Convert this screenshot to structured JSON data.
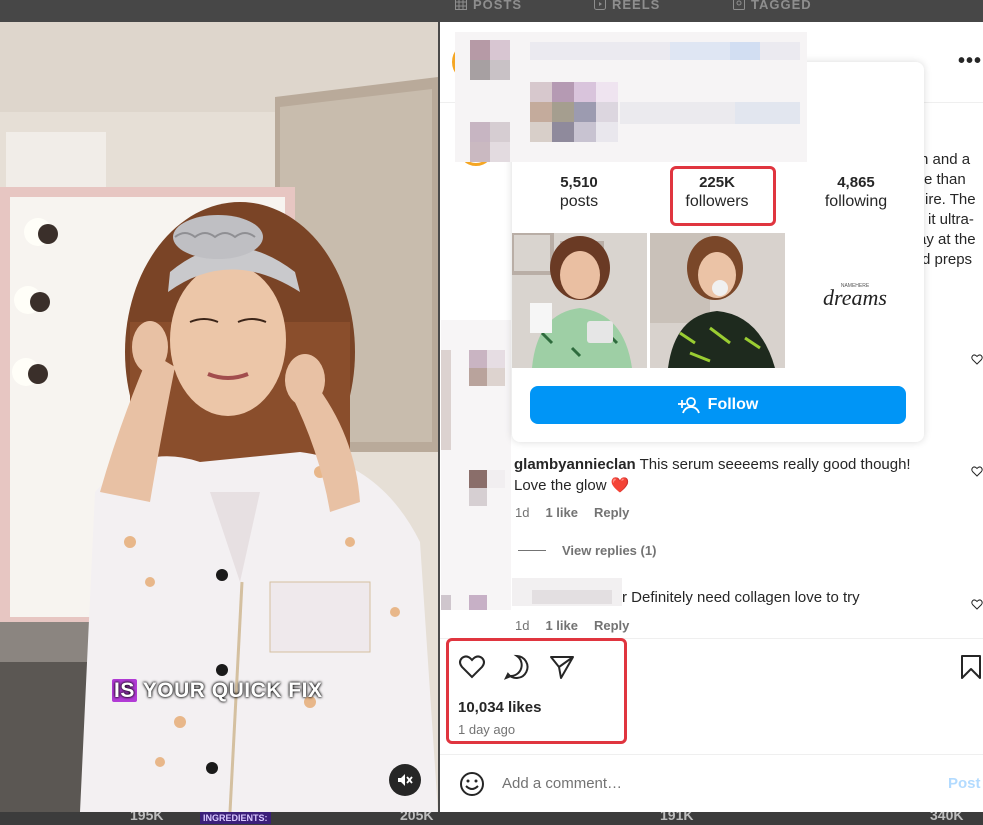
{
  "profile_tabs": [
    {
      "label": "POSTS",
      "icon": "grid-icon"
    },
    {
      "label": "REELS",
      "icon": "reels-icon"
    },
    {
      "label": "TAGGED",
      "icon": "tagged-icon"
    }
  ],
  "video": {
    "caption_highlight": "IS",
    "caption_rest": " YOUR QUICK FIX",
    "mute_icon": "speaker-muted-icon"
  },
  "post": {
    "more_label": "•••",
    "description_lines": [
      "n and a",
      "e than",
      "ire. The",
      "it ultra-",
      "ay at the",
      "d preps"
    ]
  },
  "hover_card": {
    "stats": [
      {
        "num": "5,510",
        "label": "posts"
      },
      {
        "num": "225K",
        "label": "followers"
      },
      {
        "num": "4,865",
        "label": "following"
      }
    ],
    "thumb3_brand": "dreams",
    "thumb3_brand_small": "NAMEHERE",
    "follow_label": "Follow"
  },
  "comments": [
    {
      "username": "glambyannieclan",
      "text": "This serum seeeems really good though!",
      "text2": "Love the glow",
      "emoji": "❤️",
      "time": "1d",
      "likes": "1 like",
      "reply": "Reply"
    },
    {
      "text": "r Definitely need collagen love to try",
      "time": "1d",
      "likes": "1 like",
      "reply": "Reply"
    }
  ],
  "view_replies": "View replies (1)",
  "actions": {
    "likes": "10,034 likes",
    "ago": "1 day ago"
  },
  "add_comment": {
    "placeholder": "Add a comment…",
    "post_label": "Post"
  },
  "bottom_strip": [
    {
      "label": "195K"
    },
    {
      "label": "INGREDIENTS:"
    },
    {
      "label": "205K"
    },
    {
      "label": "191K"
    },
    {
      "label": "340K"
    }
  ],
  "colors": {
    "accent": "#0095f6",
    "highlight_box": "#e0353f",
    "caption_highlight": "#b23bd6"
  }
}
